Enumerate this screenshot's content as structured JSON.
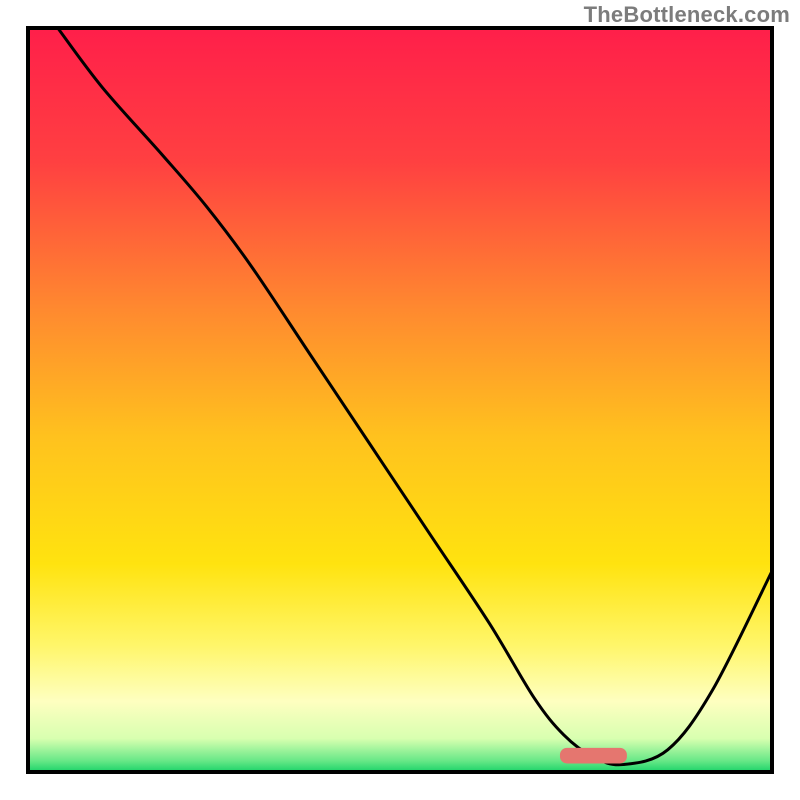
{
  "watermark": "TheBottleneck.com",
  "colors": {
    "border": "#000000",
    "line": "#000000",
    "marker": "#e5766f",
    "gradient_stops": [
      {
        "offset": 0.0,
        "color": "#ff1f4a"
      },
      {
        "offset": 0.18,
        "color": "#ff4041"
      },
      {
        "offset": 0.38,
        "color": "#ff8a2f"
      },
      {
        "offset": 0.55,
        "color": "#ffc21e"
      },
      {
        "offset": 0.72,
        "color": "#ffe30f"
      },
      {
        "offset": 0.83,
        "color": "#fff66a"
      },
      {
        "offset": 0.905,
        "color": "#feffc0"
      },
      {
        "offset": 0.955,
        "color": "#d8ffb0"
      },
      {
        "offset": 0.985,
        "color": "#67e887"
      },
      {
        "offset": 1.0,
        "color": "#19d268"
      }
    ]
  },
  "chart_data": {
    "type": "line",
    "title": "",
    "xlabel": "",
    "ylabel": "",
    "xlim": [
      0,
      100
    ],
    "ylim": [
      0,
      100
    ],
    "grid": false,
    "x": [
      4,
      10,
      18,
      24,
      30,
      38,
      46,
      54,
      62,
      68,
      72,
      76,
      80,
      86,
      92,
      100
    ],
    "values": [
      100,
      92,
      83,
      76,
      68,
      56,
      44,
      32,
      20,
      10,
      5,
      2,
      1,
      3,
      11,
      27
    ],
    "marker": {
      "x_center": 76,
      "y": 2.2,
      "width": 9,
      "height": 2.1
    }
  }
}
